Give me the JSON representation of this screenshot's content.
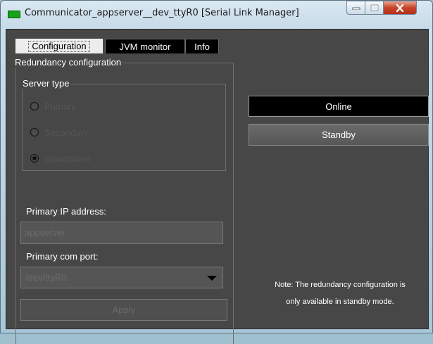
{
  "window": {
    "title": "Communicator_appserver__dev_ttyR0 [Serial Link Manager]",
    "icon": "app-status-icon"
  },
  "tabs": [
    {
      "label": "Configuration",
      "active": true
    },
    {
      "label": "JVM monitor",
      "active": false
    },
    {
      "label": "Info",
      "active": false
    }
  ],
  "redundancy": {
    "group_label": "Redundancy configuration",
    "server_type": {
      "group_label": "Server type",
      "options": [
        {
          "label": "Primary",
          "selected": false
        },
        {
          "label": "Secondary",
          "selected": false
        },
        {
          "label": "Standalone",
          "selected": true
        }
      ]
    },
    "primary_ip_label": "Primary IP address:",
    "primary_ip_value": "appserver",
    "primary_com_label": "Primary com port:",
    "primary_com_value": "/dev/ttyR0",
    "apply_label": "Apply"
  },
  "actions": {
    "online_label": "Online",
    "standby_label": "Standby"
  },
  "note": {
    "line1": "Note: The redundancy configuration is",
    "line2": "only available in standby mode."
  },
  "colors": {
    "panel_bg": "#474747",
    "active_button_bg": "#000000",
    "app_icon": "#16a21a",
    "close_button": "#c7432a"
  }
}
